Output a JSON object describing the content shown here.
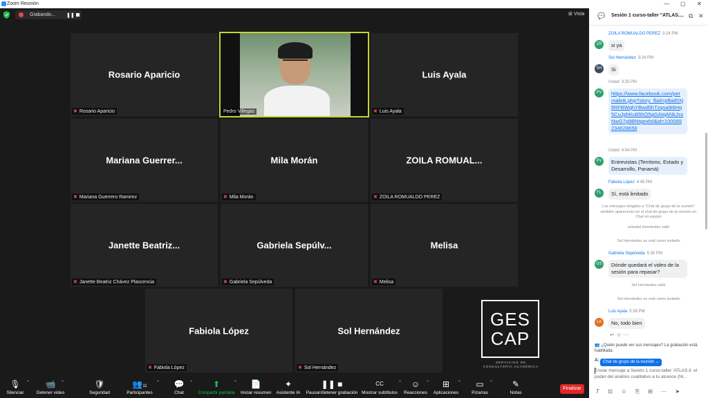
{
  "window": {
    "title": "Zoom Reunión",
    "controls": [
      "—",
      "▢",
      "✕"
    ]
  },
  "recording": {
    "label": "Grabando...",
    "pause_glyph": "❚❚"
  },
  "view_label": "Vista",
  "participants": [
    {
      "display": "Rosario Aparicio",
      "label": "Rosario Aparicio"
    },
    {
      "display": "",
      "label": "Pedro Villegas"
    },
    {
      "display": "Luis Ayala",
      "label": "Luis Ayala"
    },
    {
      "display": "Mariana  Guerrer...",
      "label": "Mariana Guerrero Ramirez"
    },
    {
      "display": "Mila Morán",
      "label": "Mila Morán"
    },
    {
      "display": "ZOILA  ROMUAL...",
      "label": "ZOILA ROMUALDO PEREZ"
    },
    {
      "display": "Janette  Beatriz...",
      "label": "Janette Beatriz Chávez Plascencia"
    },
    {
      "display": "Gabriela  Sepúlv...",
      "label": "Gabriela Sepúlveda"
    },
    {
      "display": "Melisa",
      "label": "Melisa"
    },
    {
      "display": "Fabiola López",
      "label": "Fabiola López"
    },
    {
      "display": "Sol Hernández",
      "label": "Sol Hernández"
    }
  ],
  "brand": {
    "line1": "GES",
    "line2": "CAP",
    "sub1": "SERVICIOS DE",
    "sub2": "CONSULTORÍA ACADÉMICA"
  },
  "chat": {
    "title": "Sesión 1 curso-taller \"ATLAS....",
    "messages": [
      {
        "initials": "ZR",
        "color": "#2e9e6e",
        "sender": "ZOILA ROMUALDO PEREZ",
        "time": "3:24 PM",
        "text": "si ya"
      },
      {
        "initials": "SH",
        "color": "#3b4a5e",
        "sender": "Sol Hernández",
        "time": "3:24 PM",
        "text": "Si"
      },
      {
        "initials": "PV",
        "color": "#2e9e6e",
        "sender": "Usted",
        "time": "3:25 PM",
        "text": "https://www.facebook.com/permalink.php?story_fbid=pfbid0XjfiRFBWqhYBwd5hTzqsa9i6Hq5CuJphKu85hQ5gGAtqANkJssNwG7g9BNtgexfol&id=100089234628656"
      },
      {
        "initials": "PV",
        "color": "#2e9e6e",
        "sender": "Usted",
        "time": "4:04 PM",
        "text": "Entrevistas (Territorio, Estado y Desarrollo, Panamá)"
      },
      {
        "initials": "FL",
        "color": "#2e9e6e",
        "sender": "Fabiola López",
        "time": "4:45 PM",
        "text": "Sí, está limitado"
      },
      {
        "initials": "GS",
        "color": "#2e9e6e",
        "sender": "Gabriela Sepúlveda",
        "time": "5:30 PM",
        "text": "Dónde quedará el video de la sesión para repasar?"
      },
      {
        "initials": "LA",
        "color": "#e07020",
        "sender": "Luis Ayala",
        "time": "5:38 PM",
        "text": "No, todo bien"
      }
    ],
    "system": [
      "Los mensajes dirigidos a \"Chat de grupo de la reunión\" también aparecerán en el chat de grupo de la reunión en Chat en equipo",
      "soledad Hernández salió",
      "Sol Hernández se unió como invitado",
      "Sol Hernández salió",
      "Sol Hernández se unió como invitado"
    ],
    "who_can_see": "¿Quién puede ver sus mensajes? La grabación está habilitada",
    "to_label": "A:",
    "to_value": "Chat de grupo de la reunión ⌄",
    "input_placeholder": "Enviar mensaje a Sesión 1 curso-taller 'ATLAS.ti: el poder del análisis cualitativo a tu alcance (Ni..."
  },
  "toolbar": [
    {
      "label": "Silenciar",
      "glyph": "🎙"
    },
    {
      "label": "Detener video",
      "glyph": "📹"
    },
    {
      "label": "Seguridad",
      "glyph": "🛡"
    },
    {
      "label": "Participantes",
      "glyph": "👥",
      "count": "11"
    },
    {
      "label": "Chat",
      "glyph": "💬"
    },
    {
      "label": "Compartir pantalla",
      "glyph": "⬆"
    },
    {
      "label": "Iniciar resumen",
      "glyph": "📄"
    },
    {
      "label": "Asistente IA",
      "glyph": "✦"
    },
    {
      "label": "Pausar/detener grabación",
      "glyph": "❚❚ ■"
    },
    {
      "label": "Mostrar subtítulos",
      "glyph": "CC"
    },
    {
      "label": "Reacciones",
      "glyph": "☺"
    },
    {
      "label": "Aplicaciones",
      "glyph": "⊞"
    },
    {
      "label": "Pizarras",
      "glyph": "▭"
    },
    {
      "label": "Notas",
      "glyph": "✎"
    }
  ],
  "end_label": "Finalizar"
}
